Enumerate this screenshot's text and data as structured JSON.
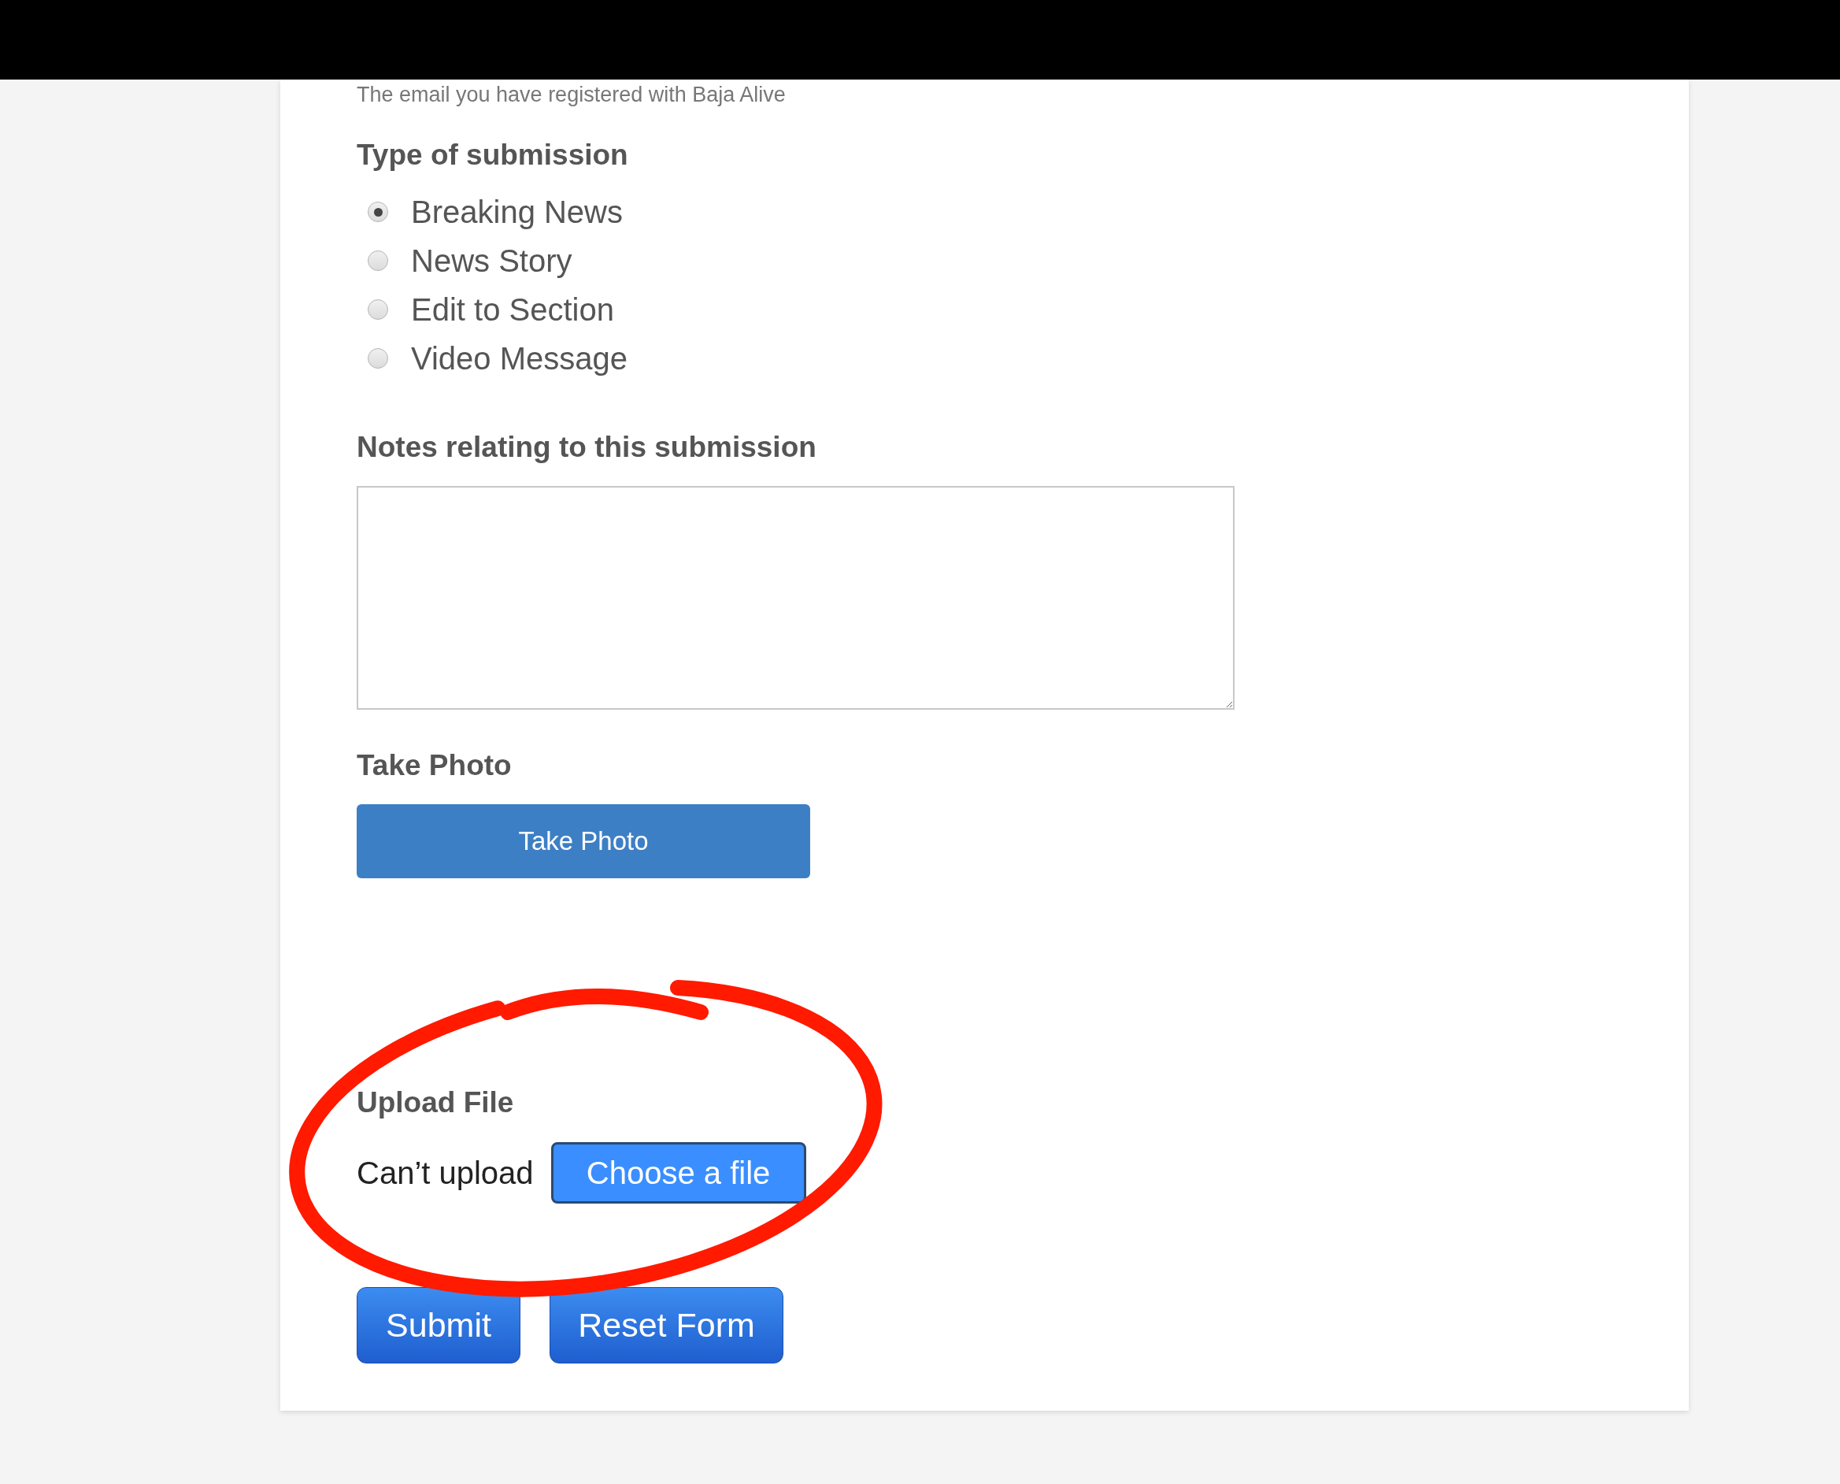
{
  "intro_text": "The email you have registered with Baja Alive",
  "submission_type": {
    "label": "Type of submission",
    "options": [
      {
        "label": "Breaking News",
        "selected": true
      },
      {
        "label": "News Story",
        "selected": false
      },
      {
        "label": "Edit to Section",
        "selected": false
      },
      {
        "label": "Video Message",
        "selected": false
      }
    ]
  },
  "notes": {
    "label": "Notes relating to this submission"
  },
  "take_photo": {
    "label": "Take Photo",
    "button": "Take Photo"
  },
  "upload": {
    "label": "Upload File",
    "status": "Can’t upload",
    "button": "Choose a file"
  },
  "buttons": [
    "Submit",
    "Reset Form"
  ],
  "annotation": {
    "kind": "circle"
  }
}
